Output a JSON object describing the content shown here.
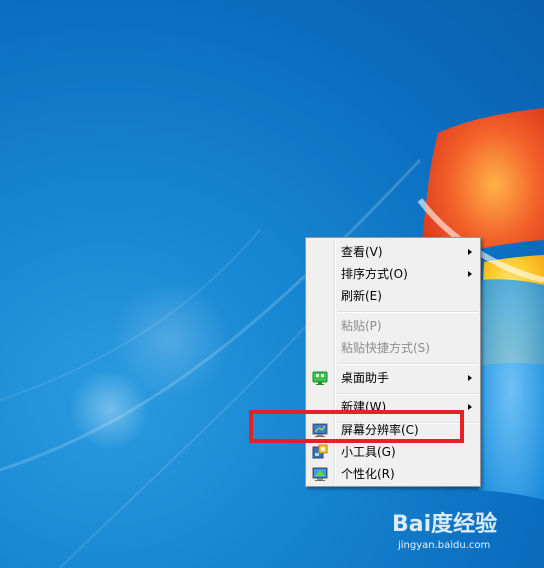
{
  "context_menu": {
    "items": [
      {
        "label": "查看(V)",
        "submenu": true,
        "disabled": false
      },
      {
        "label": "排序方式(O)",
        "submenu": true,
        "disabled": false
      },
      {
        "label": "刷新(E)",
        "submenu": false,
        "disabled": false
      },
      {
        "label": "粘贴(P)",
        "submenu": false,
        "disabled": true
      },
      {
        "label": "粘贴快捷方式(S)",
        "submenu": false,
        "disabled": true
      },
      {
        "label": "桌面助手",
        "submenu": true,
        "disabled": false,
        "icon": "desktop-assistant-icon"
      },
      {
        "label": "新建(W)",
        "submenu": true,
        "disabled": false
      },
      {
        "label": "屏幕分辨率(C)",
        "submenu": false,
        "disabled": false,
        "icon": "monitor-icon"
      },
      {
        "label": "小工具(G)",
        "submenu": false,
        "disabled": false,
        "icon": "gadgets-icon"
      },
      {
        "label": "个性化(R)",
        "submenu": false,
        "disabled": false,
        "icon": "personalize-icon"
      }
    ]
  },
  "annotation": {
    "color": "#e32127",
    "target": "屏幕分辨率(C)"
  },
  "watermark": {
    "brand": "Bai度经验",
    "url": "jingyan.baidu.com"
  },
  "colors": {
    "desktop_blue": "#1786d2",
    "menu_bg": "#f0f0f0",
    "disabled_text": "#8d8d8d"
  }
}
